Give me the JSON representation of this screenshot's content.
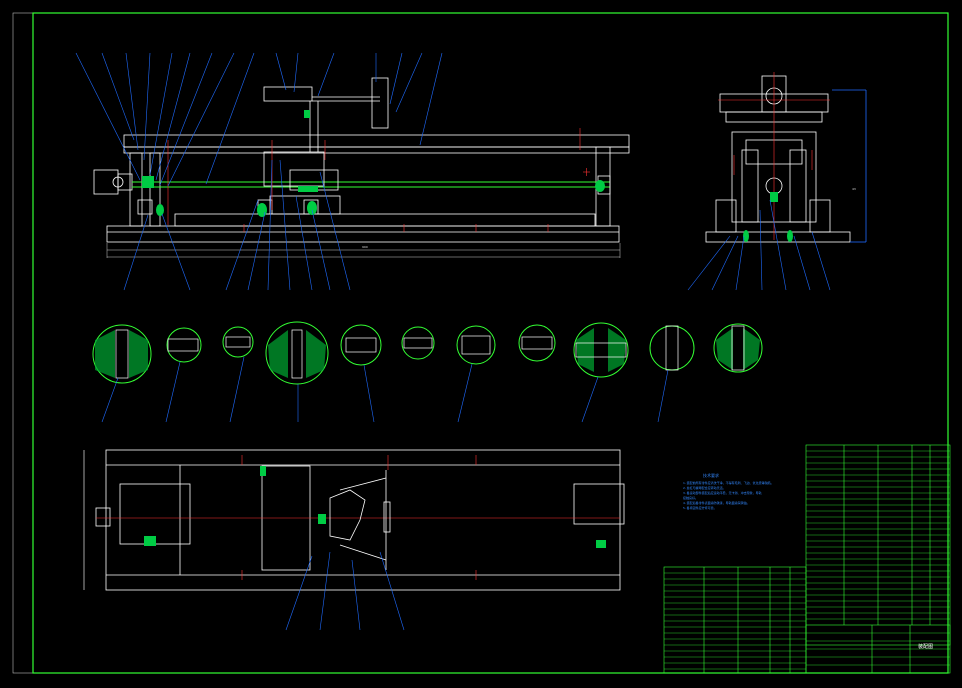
{
  "drawing": {
    "type": "cad-assembly-drawing",
    "colors": {
      "background": "#000000",
      "frame": "#33ff33",
      "outline": "#ffffff",
      "leader": "#1f6bff",
      "centerline": "#ff3333",
      "section_fill": "#00cc44",
      "title_block": "#33ff33"
    },
    "front_view": {
      "overall_dimension": "990"
    },
    "side_view": {
      "height_dimension": "43"
    },
    "notes": {
      "heading": "技术要求",
      "lines": [
        "1.装配前所有零件应清洗干净，不得有毛刺、飞边、氧化皮等缺陷。",
        "2.丝杠与螺母配合应转动灵活。",
        "3.各运动部件装配后应运动平稳，无卡滞、冲击现象，导轨",
        "接触良好。",
        "4.装配后各零件表面涂防锈漆，导轨面涂润滑油。",
        "5.各紧固件应拧紧可靠。"
      ]
    },
    "title_block": {
      "drawing_title": "装配图"
    },
    "icons": [
      "center-mark-icon",
      "section-detail-icon"
    ]
  }
}
